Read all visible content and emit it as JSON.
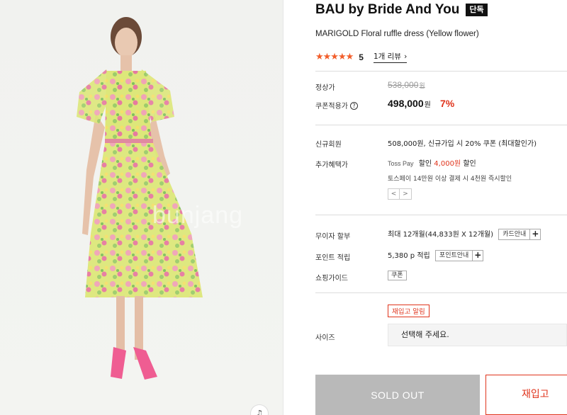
{
  "image": {
    "watermark": "bunjang",
    "alt": "model wearing yellow floral ruffle midi dress"
  },
  "product": {
    "brand": "BAU by Bride And You",
    "brand_tag": "단독",
    "name": "MARIGOLD Floral ruffle dress (Yellow flower)",
    "rating": {
      "stars": "★★★★★",
      "score": "5",
      "review_link": "1개 리뷰"
    }
  },
  "pricing": {
    "regular_label": "정상가",
    "regular_price": "538,000",
    "regular_unit": "원",
    "coupon_label": "쿠폰적용가",
    "coupon_price": "498,000",
    "coupon_unit": "원",
    "discount": "7%"
  },
  "benefits": {
    "new_member_label": "신규회원",
    "new_member_text": "508,000원, 신규가입 시 20% 쿠폰 (최대할인가)",
    "extra_label": "추가혜택가",
    "toss_brand": "Toss Pay",
    "toss_prefix": "할인",
    "toss_amount": "4,000원",
    "toss_suffix": "할인",
    "toss_condition": "토스페이 14만원 이상 결제 시 4천원 즉시할인",
    "pager_prev": "<",
    "pager_next": ">"
  },
  "payment": {
    "installment_label": "무이자 할부",
    "installment_text": "최대 12개월(44,833원 X 12개월)",
    "card_info_btn": "카드안내",
    "points_label": "포인트 적립",
    "points_text": "5,380 p 적립",
    "points_info_btn": "포인트안내",
    "plus": "+",
    "guide_label": "쇼핑가이드",
    "guide_badge": "쿠폰"
  },
  "options": {
    "restock_small": "재입고 알림",
    "size_label": "사이즈",
    "size_placeholder": "선택해 주세요."
  },
  "actions": {
    "sold_out": "SOLD OUT",
    "restock_big": "재입고",
    "floating": "♫"
  },
  "colors": {
    "accent_red": "#e0341c",
    "star_orange": "#f25e2b",
    "soldout_gray": "#b9b9b9"
  }
}
